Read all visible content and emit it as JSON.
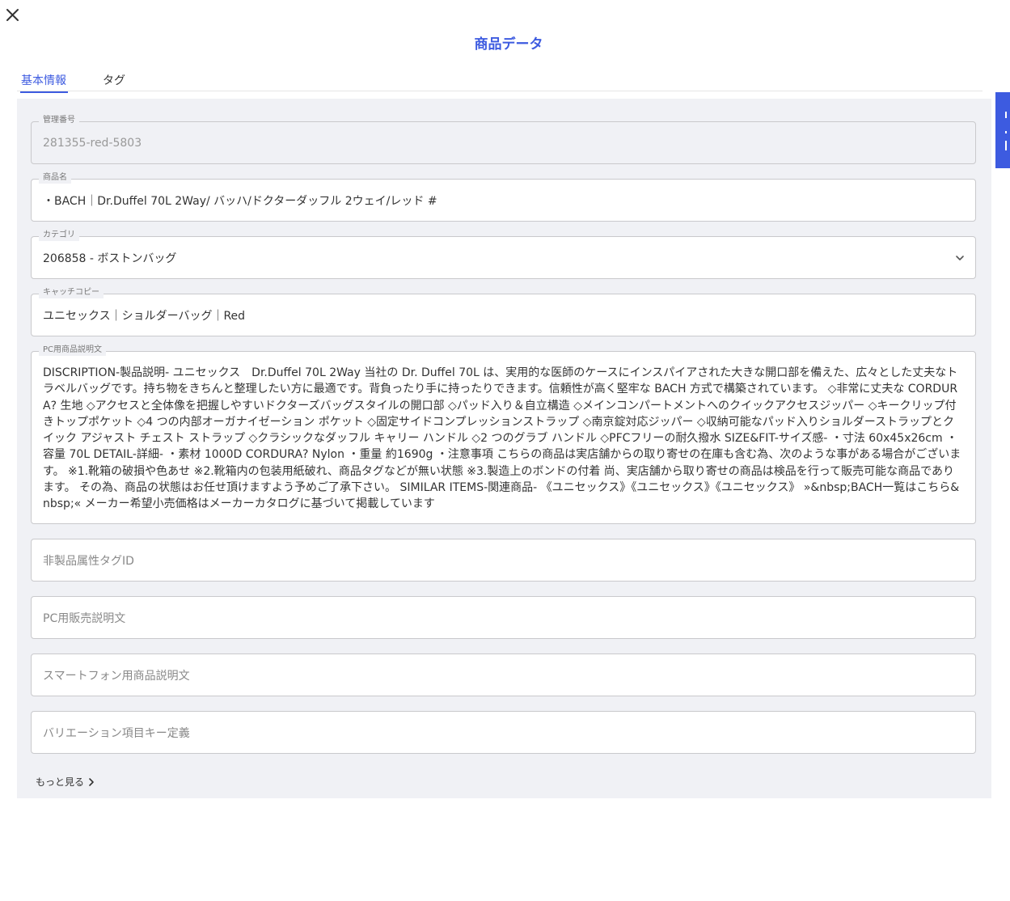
{
  "dialog": {
    "title": "商品データ",
    "close_icon": "close-icon"
  },
  "tabs": [
    {
      "label": "基本情報",
      "active": true
    },
    {
      "label": "タグ",
      "active": false
    }
  ],
  "fields": {
    "management_number": {
      "label": "管理番号",
      "value": "281355-red-5803"
    },
    "product_name": {
      "label": "商品名",
      "value": "・BACH｜Dr.Duffel 70L 2Way/ バッハ/ドクターダッフル 2ウェイ/レッド #"
    },
    "category": {
      "label": "カテゴリ",
      "value": "206858 - ボストンバッグ"
    },
    "catch_copy": {
      "label": "キャッチコピー",
      "value": "ユニセックス｜ショルダーバッグ｜Red"
    },
    "pc_description": {
      "label": "PC用商品説明文",
      "value": "DISCRIPTION-製品説明- ユニセックス　Dr.Duffel 70L 2Way 当社の Dr. Duffel 70L は、実用的な医師のケースにインスパイアされた大きな開口部を備えた、広々とした丈夫なトラベルバッグです。持ち物をきちんと整理したい方に最適です。背負ったり手に持ったりできます。信頼性が高く堅牢な BACH 方式で構築されています。 ◇非常に丈夫な CORDURA? 生地 ◇アクセスと全体像を把握しやすいドクターズバッグスタイルの開口部 ◇パッド入り＆自立構造 ◇メインコンパートメントへのクイックアクセスジッパー ◇キークリップ付きトップポケット ◇4 つの内部オーガナイゼーション ポケット ◇固定サイドコンプレッションストラップ ◇南京錠対応ジッパー ◇収納可能なパッド入りショルダーストラップとクイック アジャスト チェスト ストラップ ◇クラシックなダッフル キャリー ハンドル ◇2 つのグラブ ハンドル ◇PFCフリーの耐久撥水 SIZE&FIT-サイズ感- ・寸法 60x45x26cm ・容量 70L DETAIL-詳細- ・素材 1000D CORDURA? Nylon ・重量 約1690g ・注意事項 こちらの商品は実店舗からの取り寄せの在庫も含む為、次のような事がある場合がございます。 ※1.靴箱の破損や色あせ ※2.靴箱内の包装用紙破れ、商品タグなどが無い状態 ※3.製造上のボンドの付着 尚、実店舗から取り寄せの商品は検品を行って販売可能な商品であります。 その為、商品の状態はお任せ頂けますよう予めご了承下さい。 SIMILAR ITEMS-関連商品- 《ユニセックス》《ユニセックス》《ユニセックス》 »&nbsp;BACH一覧はこちら&nbsp;« メーカー希望小売価格はメーカーカタログに基づいて掲載しています"
    },
    "non_product_tag_id": {
      "placeholder": "非製品属性タグID"
    },
    "pc_sales_description": {
      "placeholder": "PC用販売説明文"
    },
    "smartphone_description": {
      "placeholder": "スマートフォン用商品説明文"
    },
    "variation_key": {
      "placeholder": "バリエーション項目キー定義"
    }
  },
  "more_link": {
    "label": "もっと見る",
    "icon": "chevron-right-icon"
  },
  "side_tab": {
    "icon": "side-panel-tab"
  },
  "colors": {
    "accent": "#3d5be0",
    "panel": "#f0f1f5"
  }
}
